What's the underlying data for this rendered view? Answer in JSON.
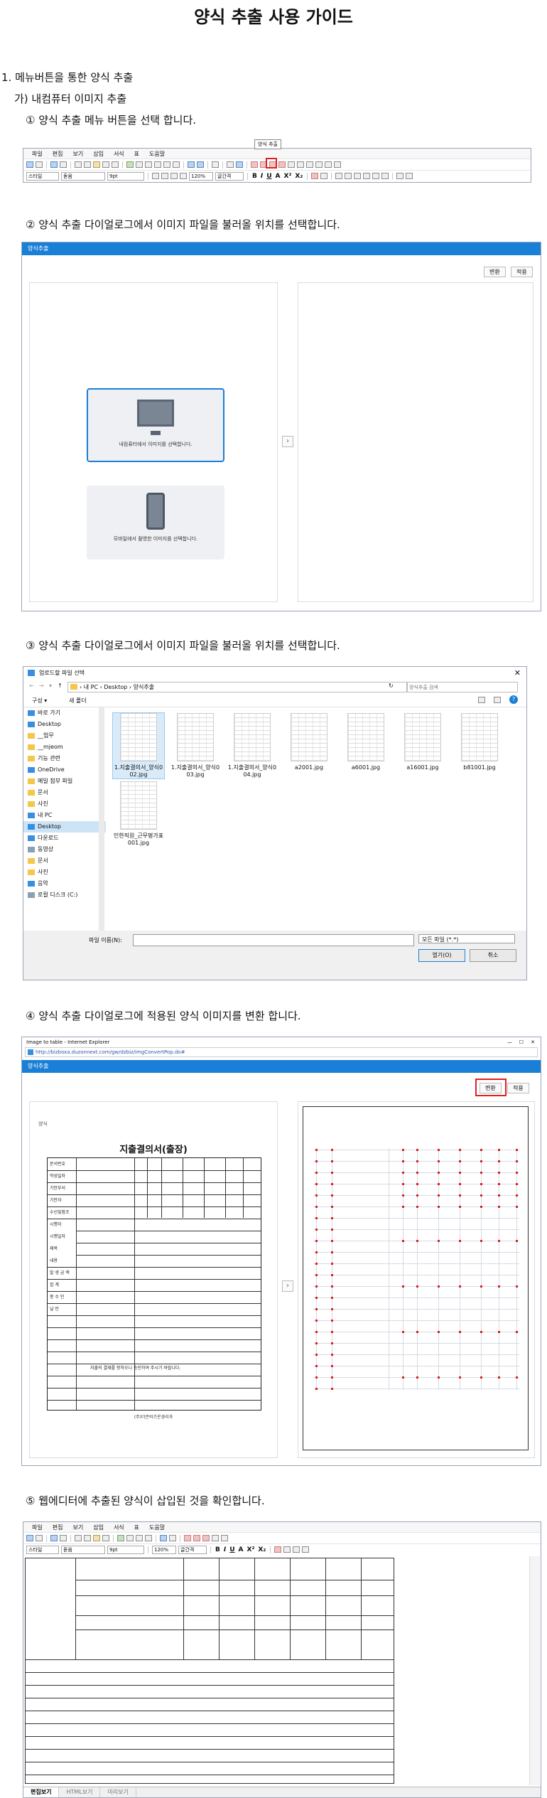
{
  "title": "양식 추출 사용 가이드",
  "section1": "1. 메뉴버튼을 통한 양식 추출",
  "sub1": "가) 내컴퓨터 이미지 추출",
  "steps": [
    "① 양식 추출 메뉴 버튼을 선택 합니다.",
    "② 양식 추출 다이얼로그에서 이미지 파일을 불러올 위치를 선택합니다.",
    "③ 양식 추출 다이얼로그에서 이미지 파일을 불러올 위치를 선택합니다.",
    "④ 양식 추출 다이얼로그에 적용된 양식 이미지를 변환 합니다.",
    "⑤ 웹에디터에 추출된 양식이 삽입된 것을 확인합니다."
  ],
  "editor": {
    "menu": [
      "파일",
      "편집",
      "보기",
      "삽입",
      "서식",
      "표",
      "도움말"
    ],
    "tooltip": "양식 추출",
    "style_select": "스타일",
    "font_select": "돋움",
    "size_select": "9pt",
    "zoom_select": "120%",
    "spacing_select": "글간격",
    "format_buttons": [
      "B",
      "I",
      "U",
      "A",
      "X²",
      "X₂"
    ],
    "tabs": [
      "편집보기",
      "HTML보기",
      "미리보기"
    ]
  },
  "dialog": {
    "title": "양식추출",
    "convert": "변환",
    "apply": "적용",
    "pc_label": "내컴퓨터에서 이미지를 선택합니다.",
    "mobile_label": "모바일에서 촬영한 이미지를 선택합니다.",
    "next": "›"
  },
  "filedialog": {
    "title": "업로드할 파일 선택",
    "path": [
      "내 PC",
      "Desktop",
      "양식추출"
    ],
    "search_placeholder": "양식추출 검색",
    "organize": "구성 ▾",
    "new_folder": "새 폴더",
    "nav": [
      {
        "label": "바로 가기",
        "icon": "star"
      },
      {
        "label": "Desktop",
        "icon": "desktop"
      },
      {
        "label": "__업무",
        "icon": "folder"
      },
      {
        "label": "__mjeom",
        "icon": "folder"
      },
      {
        "label": "기능 관련",
        "icon": "folder"
      },
      {
        "label": "OneDrive",
        "icon": "cloud"
      },
      {
        "label": "메일 첨부 파일",
        "icon": "folder"
      },
      {
        "label": "문서",
        "icon": "folder"
      },
      {
        "label": "사진",
        "icon": "folder"
      },
      {
        "label": "내 PC",
        "icon": "pc"
      },
      {
        "label": "Desktop",
        "icon": "desktop"
      },
      {
        "label": "다운로드",
        "icon": "download"
      },
      {
        "label": "동영상",
        "icon": "video"
      },
      {
        "label": "문서",
        "icon": "folder"
      },
      {
        "label": "사진",
        "icon": "folder"
      },
      {
        "label": "음악",
        "icon": "music"
      },
      {
        "label": "로컬 디스크 (C:)",
        "icon": "disk"
      }
    ],
    "files": [
      "1.지출결의서_양식002.jpg",
      "1.지출결의서_양식003.jpg",
      "1.지출결의서_양식004.jpg",
      "a2001.jpg",
      "a6001.jpg",
      "a16001.jpg",
      "b81001.jpg",
      "인한직원_근무평가표001.jpg"
    ],
    "filename_label": "파일 이름(N):",
    "filter": "모든 파일 (*.*)",
    "open": "열기(O)",
    "cancel": "취소"
  },
  "ie": {
    "title": "Image to table - Internet Explorer",
    "url": "http://bizboxa.duzonnext.com/gw/dzbiz/imgConvertPop.do#",
    "dialog_title": "양식추출",
    "convert": "변환",
    "apply": "적용",
    "form_title": "지출결의서(출장)",
    "form_small": "양식",
    "form_labels": [
      "문서번호",
      "작성일자",
      "기안부서",
      "기안자",
      "수신및참조",
      "시행자",
      "시행일자",
      "제목",
      "내용",
      "발 생 금 액",
      "합 계",
      "봉 수 인",
      "날 인"
    ],
    "form_note": "지출의 결재를 청하오니 승인하여 주시기 바랍니다.",
    "form_footer": "(주)더존비즈온경리과"
  }
}
